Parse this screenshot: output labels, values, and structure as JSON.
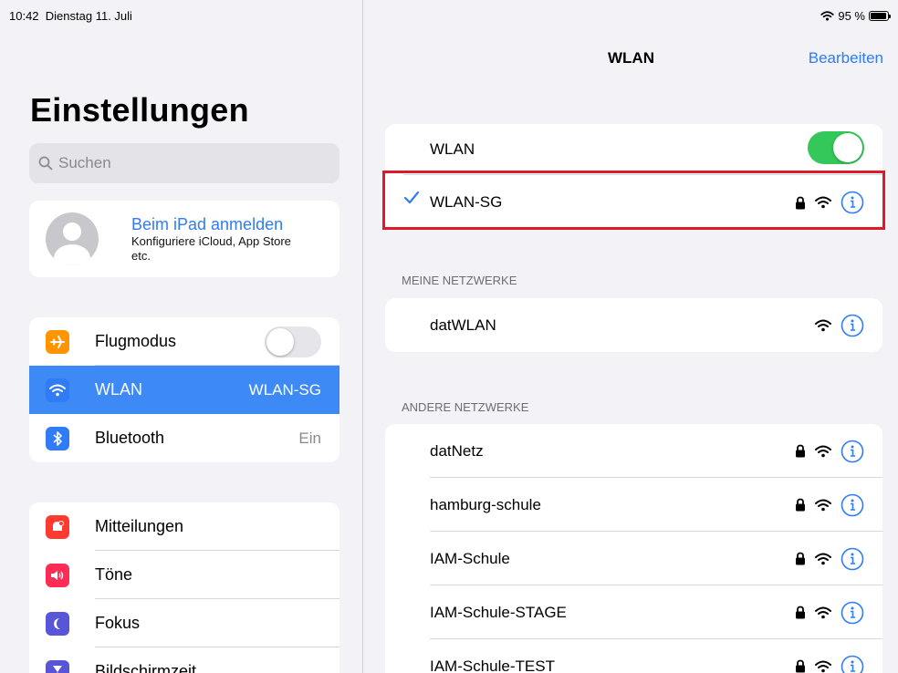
{
  "status": {
    "time": "10:42",
    "date": "Dienstag 11. Juli",
    "battery": "95 %",
    "battery_level": 0.95
  },
  "sidebar": {
    "title": "Einstellungen",
    "search_placeholder": "Suchen",
    "account": {
      "title": "Beim iPad anmelden",
      "subtitle": "Konfiguriere iCloud, App Store etc."
    },
    "group1": [
      {
        "label": "Flugmodus",
        "icon": "airplane-icon",
        "color": "#ff9500",
        "toggle": false
      },
      {
        "label": "WLAN",
        "value": "WLAN-SG",
        "icon": "wifi-icon",
        "color": "#2f7cf6",
        "active": true
      },
      {
        "label": "Bluetooth",
        "value": "Ein",
        "icon": "bluetooth-icon",
        "color": "#2f7cf6"
      }
    ],
    "group2": [
      {
        "label": "Mitteilungen",
        "icon": "notifications-icon",
        "color": "#ff3b30"
      },
      {
        "label": "Töne",
        "icon": "sound-icon",
        "color": "#ff2d55"
      },
      {
        "label": "Fokus",
        "icon": "moon-icon",
        "color": "#5856d6"
      },
      {
        "label": "Bildschirmzeit",
        "icon": "hourglass-icon",
        "color": "#5856d6"
      }
    ]
  },
  "detail": {
    "title": "WLAN",
    "edit_label": "Bearbeiten",
    "wlan_label": "WLAN",
    "wlan_enabled": true,
    "connected_network": "WLAN-SG",
    "my_networks_header": "MEINE NETZWERKE",
    "my_networks": [
      {
        "name": "datWLAN",
        "locked": false
      }
    ],
    "other_networks_header": "ANDERE NETZWERKE",
    "other_networks": [
      {
        "name": "datNetz",
        "locked": true
      },
      {
        "name": "hamburg-schule",
        "locked": true
      },
      {
        "name": "IAM-Schule",
        "locked": true
      },
      {
        "name": "IAM-Schule-STAGE",
        "locked": true
      },
      {
        "name": "IAM-Schule-TEST",
        "locked": true
      }
    ]
  },
  "colors": {
    "accent": "#2f7cf6",
    "toggle_on": "#34c759",
    "highlight": "#e0182a"
  }
}
